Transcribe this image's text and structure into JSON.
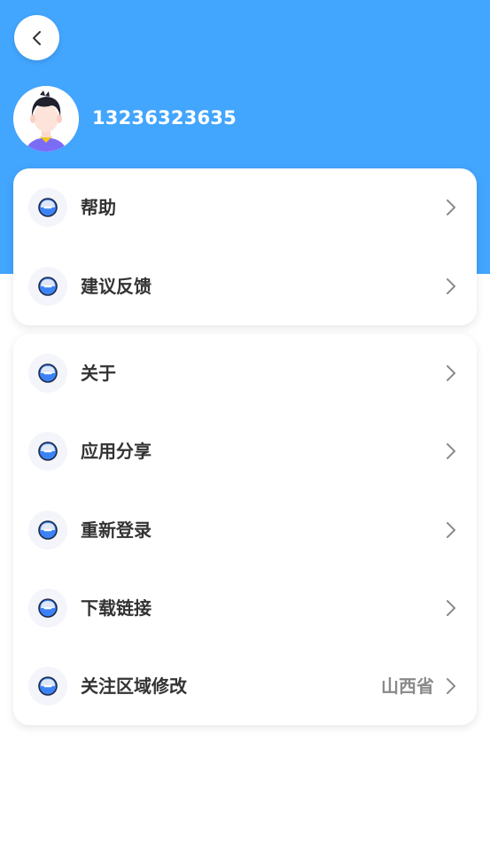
{
  "header": {
    "phone": "13236323635",
    "colors": {
      "background": "#42a5fe",
      "text": "#ffffff"
    }
  },
  "icons": {
    "back": "chevron-left-icon",
    "avatar": "user-avatar",
    "row_icon": "minus-circle-icon",
    "row_arrow": "chevron-right-icon"
  },
  "menu_groups": [
    {
      "items": [
        {
          "label": "帮助"
        },
        {
          "label": "建议反馈"
        }
      ]
    },
    {
      "items": [
        {
          "label": "关于"
        },
        {
          "label": "应用分享"
        },
        {
          "label": "重新登录"
        },
        {
          "label": "下载链接"
        },
        {
          "label": "关注区域修改",
          "value": "山西省"
        }
      ]
    }
  ],
  "colors": {
    "accent": "#3b82f6",
    "label": "#333333",
    "value": "#8a8a8a"
  }
}
